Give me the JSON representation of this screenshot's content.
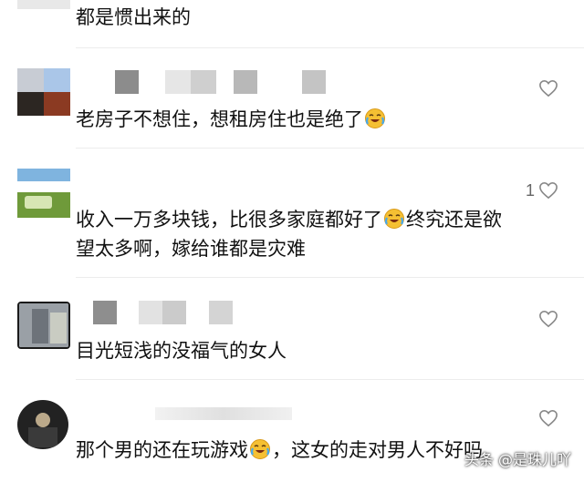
{
  "comments": [
    {
      "text": "都是惯出来的"
    },
    {
      "text": "老房子不想住，想租房住也是绝了",
      "emoji": "crying-laughing-emoji"
    },
    {
      "like_count": "1",
      "line1_before": "收入一万多块钱，比很多家庭都好了",
      "emoji": "crying-laughing-emoji",
      "line1_after": "终究还是欲",
      "line2": "望太多啊，嫁给谁都是灾难"
    },
    {
      "text": "目光短浅的没福气的女人"
    },
    {
      "text_before": "那个男的还在玩游戏",
      "emoji": "crying-laughing-emoji",
      "text_after": "，这女的走对男人不好吗"
    }
  ],
  "watermark": "头条 @是珠儿吖",
  "icons": {
    "like": "heart-outline-icon"
  },
  "colors": {
    "text": "#111111",
    "like_icon": "#888888",
    "divider": "#ececec"
  }
}
